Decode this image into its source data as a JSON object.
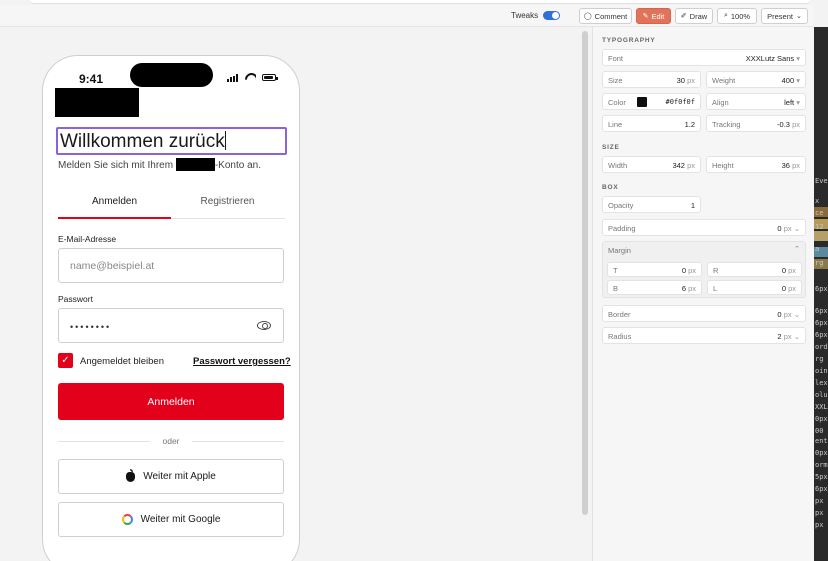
{
  "toolbar": {
    "tweaks_label": "Tweaks",
    "comment_label": "Comment",
    "edit_label": "Edit",
    "draw_label": "Draw",
    "zoom_label": "100%",
    "present_label": "Present"
  },
  "phone": {
    "time": "9:41",
    "title": "Willkommen zurück",
    "subtitle_before": "Melden Sie sich mit Ihrem",
    "subtitle_after": "-Konto an.",
    "tabs": [
      {
        "label": "Anmelden",
        "active": true
      },
      {
        "label": "Registrieren",
        "active": false
      }
    ],
    "email_label": "E-Mail-Adresse",
    "email_placeholder": "name@beispiel.at",
    "password_label": "Passwort",
    "password_value": "••••••••",
    "remember_label": "Angemeldet bleiben",
    "remember_checked": true,
    "forgot_label": "Passwort vergessen?",
    "submit_label": "Anmelden",
    "divider_label": "oder",
    "apple_label": "Weiter mit Apple",
    "google_label": "Weiter mit Google"
  },
  "inspector": {
    "typography_heading": "TYPOGRAPHY",
    "font": {
      "label": "Font",
      "value": "XXXLutz Sans"
    },
    "size": {
      "label": "Size",
      "value": "30",
      "unit": "px"
    },
    "weight": {
      "label": "Weight",
      "value": "400"
    },
    "color": {
      "label": "Color",
      "value": "#0f0f0f"
    },
    "align": {
      "label": "Align",
      "value": "left"
    },
    "line": {
      "label": "Line",
      "value": "1.2"
    },
    "tracking": {
      "label": "Tracking",
      "value": "-0.3",
      "unit": "px"
    },
    "size_heading": "SIZE",
    "width": {
      "label": "Width",
      "value": "342",
      "unit": "px"
    },
    "height": {
      "label": "Height",
      "value": "36",
      "unit": "px"
    },
    "box_heading": "BOX",
    "opacity": {
      "label": "Opacity",
      "value": "1"
    },
    "padding": {
      "label": "Padding",
      "value": "0",
      "unit": "px"
    },
    "margin": {
      "label": "Margin"
    },
    "margin_t": {
      "label": "T",
      "value": "0",
      "unit": "px"
    },
    "margin_r": {
      "label": "R",
      "value": "0",
      "unit": "px"
    },
    "margin_b": {
      "label": "B",
      "value": "6",
      "unit": "px"
    },
    "margin_l": {
      "label": "L",
      "value": "0",
      "unit": "px"
    },
    "border": {
      "label": "Border",
      "value": "0",
      "unit": "px"
    },
    "radius": {
      "label": "Radius",
      "value": "2",
      "unit": "px"
    }
  },
  "devtools_fragments": [
    "Eve",
    "x",
    "ce",
    "12",
    "a",
    "rg",
    "6px",
    "6px",
    "6px",
    "6px",
    "ord",
    "rg",
    "oin",
    "lex",
    "olu",
    "XXL",
    "0px",
    "00",
    "ent",
    "0px",
    "orm",
    "5px",
    "6px",
    "px",
    "px",
    "px"
  ],
  "colors": {
    "accent_red": "#e3001b",
    "focus_purple": "#8a63d8",
    "edit_orange": "#e0735a",
    "toggle_blue": "#2f6fd6"
  }
}
